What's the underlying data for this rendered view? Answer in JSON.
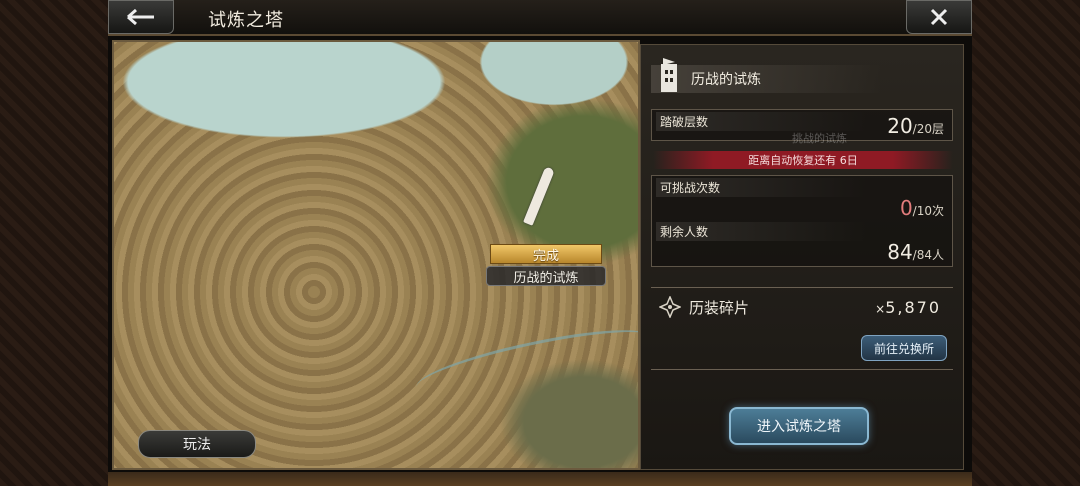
{
  "header": {
    "title": "试炼之塔",
    "back_icon": "arrow-left-icon",
    "close_icon": "close-icon"
  },
  "map": {
    "marker": {
      "status": "完成",
      "name": "历战的试炼"
    },
    "rules_button": "玩法"
  },
  "panel": {
    "title": "历战的试炼",
    "watermark_text": "挑战的试炼",
    "floors": {
      "label": "踏破层数",
      "value": "20",
      "max": "/20层"
    },
    "recover_notice": "距离自动恢复还有 6日",
    "challenges": {
      "label": "可挑战次数",
      "value": "0",
      "max": "/10次"
    },
    "remaining": {
      "label": "剩余人数",
      "value": "84",
      "max": "/84人"
    },
    "shards": {
      "label": "历装碎片",
      "prefix": "×",
      "count": "5,870"
    },
    "exchange_button": "前往兑换所",
    "enter_button": "进入试炼之塔"
  },
  "colors": {
    "accent_red": "#8f1a24",
    "button_blue": "#3c5d78",
    "banner_gold": "#f1c768"
  }
}
